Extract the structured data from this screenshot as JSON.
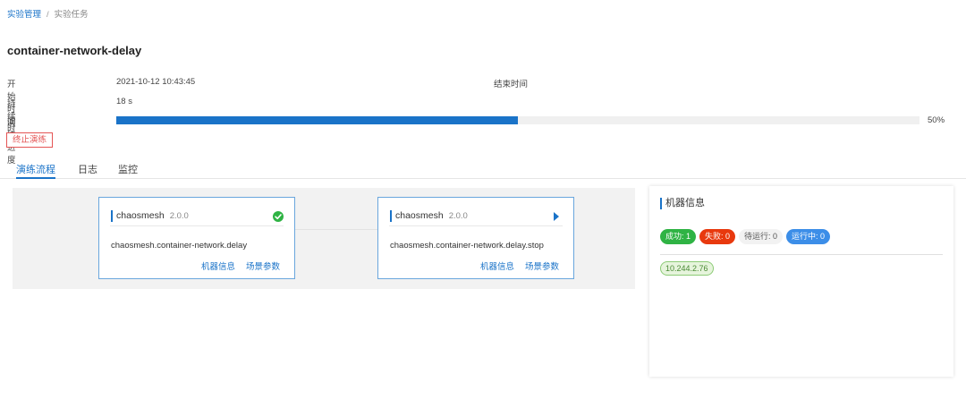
{
  "breadcrumb": {
    "parent": "实验管理",
    "separator": "/",
    "current": "实验任务"
  },
  "page_title": "container-network-delay",
  "info": {
    "start_label": "开始时间",
    "start_value": "2021-10-12 10:43:45",
    "end_label": "结束时间",
    "duration_label": "持续时长",
    "duration_value": "18 s",
    "progress_label": "演练进度",
    "progress_fraction": 0.5,
    "progress_text": "50%"
  },
  "stop_button": "终止演练",
  "tabs": [
    {
      "label": "演练流程",
      "active": true
    },
    {
      "label": "日志",
      "active": false
    },
    {
      "label": "监控",
      "active": false
    }
  ],
  "flow_nodes": [
    {
      "name": "chaosmesh",
      "version": "2.0.0",
      "action": "chaosmesh.container-network.delay",
      "status_icon": "success-check-icon",
      "link_machine": "机器信息",
      "link_params": "场景参数"
    },
    {
      "name": "chaosmesh",
      "version": "2.0.0",
      "action": "chaosmesh.container-network.delay.stop",
      "status_icon": "play-icon",
      "link_machine": "机器信息",
      "link_params": "场景参数"
    }
  ],
  "machine_panel": {
    "title": "机器信息",
    "badges": {
      "success": "成功: 1",
      "fail": "失败: 0",
      "pending": "待运行: 0",
      "running": "运行中: 0"
    },
    "ips": [
      "10.244.2.76"
    ]
  },
  "colors": {
    "accent": "#1a73c8",
    "success": "#2fb344",
    "fail": "#e8390e",
    "running": "#3c8ee8",
    "stop": "#e45454"
  }
}
